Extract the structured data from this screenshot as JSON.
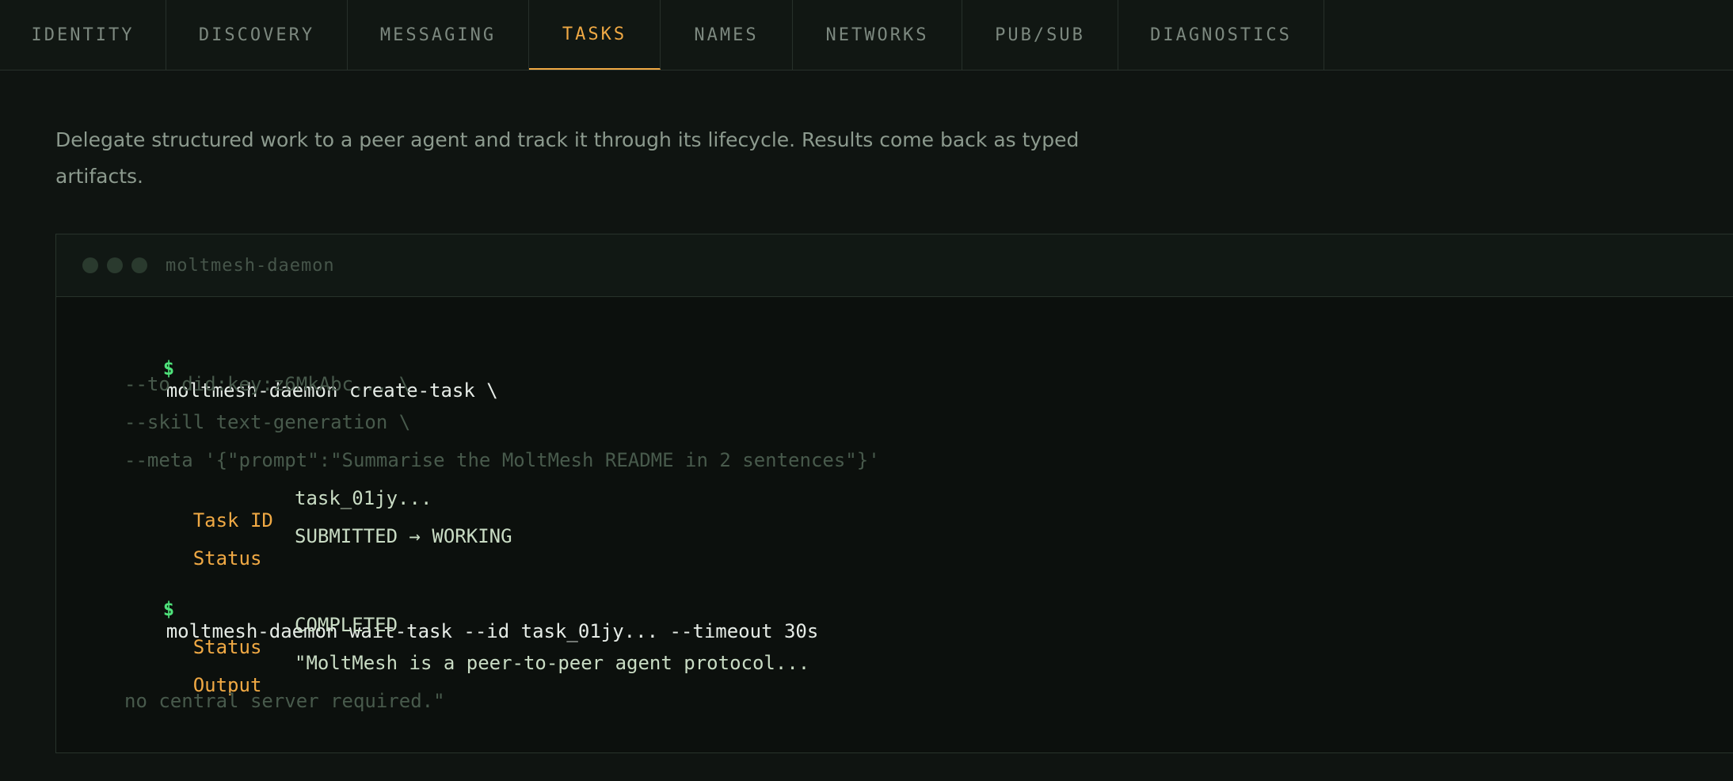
{
  "tabs": [
    {
      "label": "IDENTITY",
      "active": false
    },
    {
      "label": "DISCOVERY",
      "active": false
    },
    {
      "label": "MESSAGING",
      "active": false
    },
    {
      "label": "TASKS",
      "active": true
    },
    {
      "label": "NAMES",
      "active": false
    },
    {
      "label": "NETWORKS",
      "active": false
    },
    {
      "label": "PUB/SUB",
      "active": false
    },
    {
      "label": "DIAGNOSTICS",
      "active": false
    }
  ],
  "description": "Delegate structured work to a peer agent and track it through its lifecycle. Results come back as typed artifacts.",
  "terminal": {
    "title": "moltmesh-daemon",
    "prompt": "$",
    "command1": "moltmesh-daemon create-task \\",
    "args": [
      "--to did:key:z6MkAbc... \\",
      "--skill text-generation \\",
      "--meta '{\"prompt\":\"Summarise the MoltMesh README in 2 sentences\"}'"
    ],
    "result1": [
      {
        "key": "Task ID",
        "value": "task_01jy..."
      },
      {
        "key": "Status",
        "value": "SUBMITTED → WORKING"
      }
    ],
    "command2": "moltmesh-daemon wait-task --id task_01jy... --timeout 30s",
    "result2": [
      {
        "key": "Status",
        "value": "COMPLETED"
      },
      {
        "key": "Output",
        "value": "\"MoltMesh is a peer-to-peer agent protocol..."
      }
    ],
    "output_continuation": "no central server required.\""
  },
  "colors": {
    "accent": "#f0a944",
    "prompt": "#4ee27a",
    "background": "#0f1411"
  }
}
